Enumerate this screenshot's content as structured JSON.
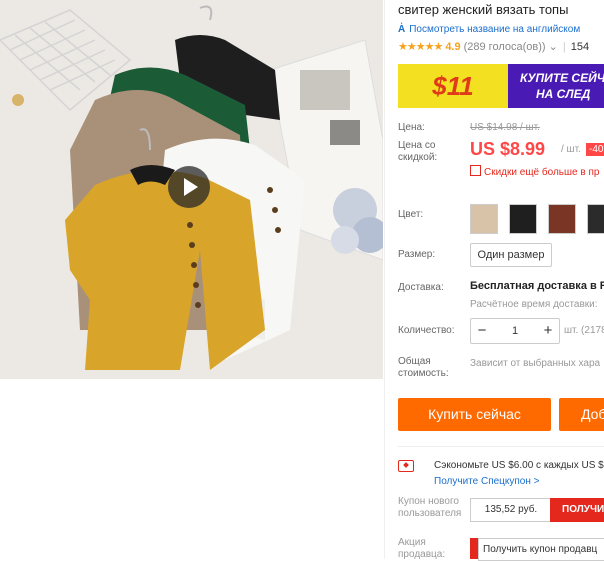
{
  "product": {
    "title": "свитер женский вязать топы",
    "translate_link": "Посмотреть название на английском",
    "translate_icon": "translate-icon",
    "rating": "4.9",
    "reviews": "(289 голоса(ов))",
    "orders": "154"
  },
  "banner": {
    "price": "$11",
    "line1": "КУПИТЕ СЕЙЧ",
    "line2": "НА СЛЕД"
  },
  "price": {
    "label": "Цена:",
    "original": "US $14.98 / шт.",
    "discount_label": "Цена со скидкой:",
    "current": "US $8.99",
    "unit": "/ шт.",
    "discount": "-40%",
    "qr_text": "Скидки ещё больше в пр"
  },
  "options": {
    "color_label": "Цвет:",
    "swatch_colors": [
      "#d8c3a8",
      "#1f1f1f",
      "#7a3524",
      "#2b2b2b"
    ],
    "size_label": "Размер:",
    "size_value": "Один размер"
  },
  "shipping": {
    "label": "Доставка:",
    "text": "Бесплатная доставка в Ru",
    "estimate": "Расчётное время доставки: "
  },
  "quantity": {
    "label": "Количество:",
    "minus": "−",
    "value": "1",
    "plus": "+",
    "stock": "шт. (2178"
  },
  "total": {
    "label": "Общая стоимость:",
    "value": "Зависит от выбранных хара"
  },
  "actions": {
    "buy_now": "Купить сейчас",
    "add_to_cart": "Доб"
  },
  "coupons": {
    "save_text": "Сэкономьте US $6.00 с каждых US $",
    "spec_link": "Получите Спецкупон >",
    "new_user_label": "Купон нового пользователя",
    "new_user_value": "135,52 руб.",
    "get_button": "ПОЛУЧИ",
    "promo_label": "Акция продавца:",
    "promo_text": "Получить купон продавц"
  },
  "colors": {
    "accent": "#ff4747",
    "buy": "#ff6a00",
    "link": "#1b6fce",
    "star": "#f7a21b"
  }
}
